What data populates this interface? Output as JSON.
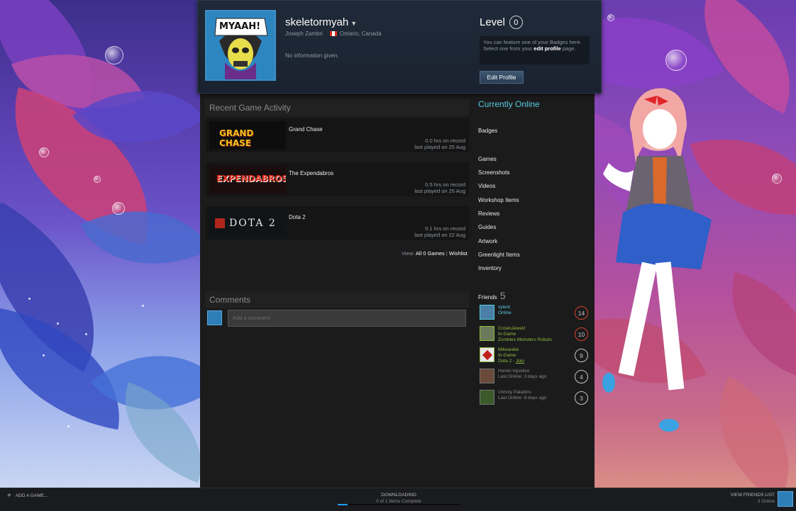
{
  "profile": {
    "persona_name": "skeletormyah",
    "real_name": "Joseph Zambri",
    "location": "Ontario, Canada",
    "summary": "No information given.",
    "avatar_text": "MYAAH!",
    "level_label": "Level",
    "level_value": "0",
    "badge_hint_1": "You can feature one of your Badges here.",
    "badge_hint_2": "Select one from your",
    "badge_hint_link": "edit profile",
    "badge_hint_3": "page.",
    "edit_button": "Edit Profile"
  },
  "recent_activity": {
    "title": "Recent Game Activity",
    "games": [
      {
        "name": "Grand Chase",
        "capsule_text": "GRAND CHASE",
        "hours": "0.0 hrs on record",
        "last_played": "last played on 25 Aug"
      },
      {
        "name": "The Expendabros",
        "capsule_text": "EXPENDABROS",
        "hours": "0.5 hrs on record",
        "last_played": "last played on 25 Aug"
      },
      {
        "name": "Dota 2",
        "capsule_text": "DOTA 2",
        "hours": "0.1 hrs on record",
        "last_played": "last played on 22 Aug"
      }
    ],
    "view_label": "View:",
    "all_games": "All 0 Games",
    "separator": "|",
    "wishlist": "Wishlist"
  },
  "comments": {
    "title": "Comments",
    "placeholder": "Add a comment"
  },
  "sidebar": {
    "status": "Currently Online",
    "badges": "Badges",
    "links": [
      "Games",
      "Screenshots",
      "Videos",
      "Workshop Items",
      "Reviews",
      "Guides",
      "Artwork",
      "Greenlight Items",
      "Inventory"
    ],
    "friends_label": "Friends",
    "friends_count": "5",
    "friends": [
      {
        "name": "xylent",
        "status": "Online",
        "game": "",
        "level": "14",
        "state": "online",
        "level_color": "#d94126"
      },
      {
        "name": "CrownJewelz",
        "status": "In-Game",
        "game": "Zombies Monsters Robots",
        "level": "10",
        "state": "ingame",
        "level_color": "#d94126"
      },
      {
        "name": "Mikeanike",
        "status": "In-Game",
        "game": "Dota 2 - ",
        "join": "Join",
        "level": "9",
        "state": "ingame",
        "level_color": "#c6c6c6"
      },
      {
        "name": "Heroic Injustice",
        "status": "Last Online: 3 days ago",
        "game": "",
        "level": "4",
        "state": "offline",
        "level_color": "#c6c6c6"
      },
      {
        "name": "Unholy Paladins",
        "status": "Last Online: 6 days ago",
        "game": "",
        "level": "3",
        "state": "offline",
        "level_color": "#c6c6c6"
      }
    ]
  },
  "taskbar": {
    "add_game": "ADD A GAME...",
    "downloading": "DOWNLOADING",
    "download_sub": "0 of 1 Items Complete",
    "download_progress": 0.08,
    "view_friends": "VIEW FRIENDS LIST",
    "friends_online": "3 Online"
  },
  "colors": {
    "accent_online": "#57cbde",
    "ingame": "#90ba3c",
    "offline": "#898989",
    "progress": "#1a9fff"
  }
}
